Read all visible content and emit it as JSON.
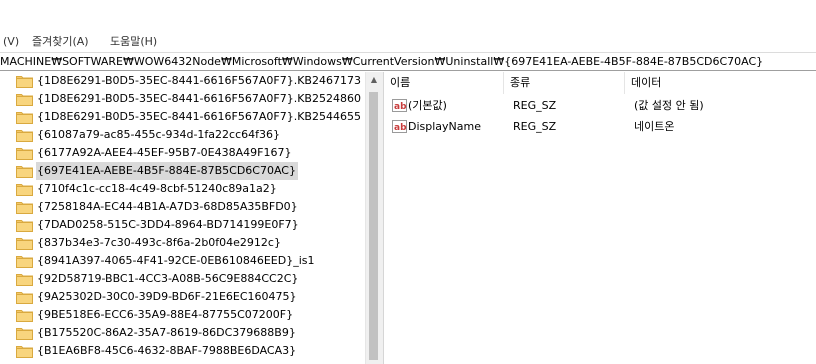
{
  "menu": [
    "(V)",
    "즐겨찾기(A)",
    "도움말(H)"
  ],
  "address": "MACHINE₩SOFTWARE₩WOW6432Node₩Microsoft₩Windows₩CurrentVersion₩Uninstall₩{697E41EA-AEBE-4B5F-884E-87B5CD6C70AC}",
  "tree": {
    "items": [
      {
        "label": "{1D8E6291-B0D5-35EC-8441-6616F567A0F7}.KB2467173",
        "selected": false
      },
      {
        "label": "{1D8E6291-B0D5-35EC-8441-6616F567A0F7}.KB2524860",
        "selected": false
      },
      {
        "label": "{1D8E6291-B0D5-35EC-8441-6616F567A0F7}.KB2544655",
        "selected": false
      },
      {
        "label": "{61087a79-ac85-455c-934d-1fa22cc64f36}",
        "selected": false
      },
      {
        "label": "{6177A92A-AEE4-45EF-95B7-0E438A49F167}",
        "selected": false
      },
      {
        "label": "{697E41EA-AEBE-4B5F-884E-87B5CD6C70AC}",
        "selected": true
      },
      {
        "label": "{710f4c1c-cc18-4c49-8cbf-51240c89a1a2}",
        "selected": false
      },
      {
        "label": "{7258184A-EC44-4B1A-A7D3-68D85A35BFD0}",
        "selected": false
      },
      {
        "label": "{7DAD0258-515C-3DD4-8964-BD714199E0F7}",
        "selected": false
      },
      {
        "label": "{837b34e3-7c30-493c-8f6a-2b0f04e2912c}",
        "selected": false
      },
      {
        "label": "{8941A397-4065-4F41-92CE-0EB610846EED}_is1",
        "selected": false
      },
      {
        "label": "{92D58719-BBC1-4CC3-A08B-56C9E884CC2C}",
        "selected": false
      },
      {
        "label": "{9A25302D-30C0-39D9-BD6F-21E6EC160475}",
        "selected": false
      },
      {
        "label": "{9BE518E6-ECC6-35A9-88E4-87755C07200F}",
        "selected": false
      },
      {
        "label": "{B175520C-86A2-35A7-8619-86DC379688B9}",
        "selected": false
      },
      {
        "label": "{B1EA6BF8-45C6-4632-8BAF-7988BE6DACA3}",
        "selected": false
      }
    ]
  },
  "values": {
    "columns": [
      "이름",
      "종류",
      "데이터"
    ],
    "rows": [
      {
        "name": "(기본값)",
        "type": "REG_SZ",
        "data": "(값 설정 안 됨)",
        "icon": "string-value-icon"
      },
      {
        "name": "DisplayName",
        "type": "REG_SZ",
        "data": "네이트온",
        "icon": "string-value-icon"
      }
    ]
  },
  "colors": {
    "folder": "#f5c96a",
    "selection": "#d9d9d9",
    "value_icon_red": "#c83c3c"
  }
}
